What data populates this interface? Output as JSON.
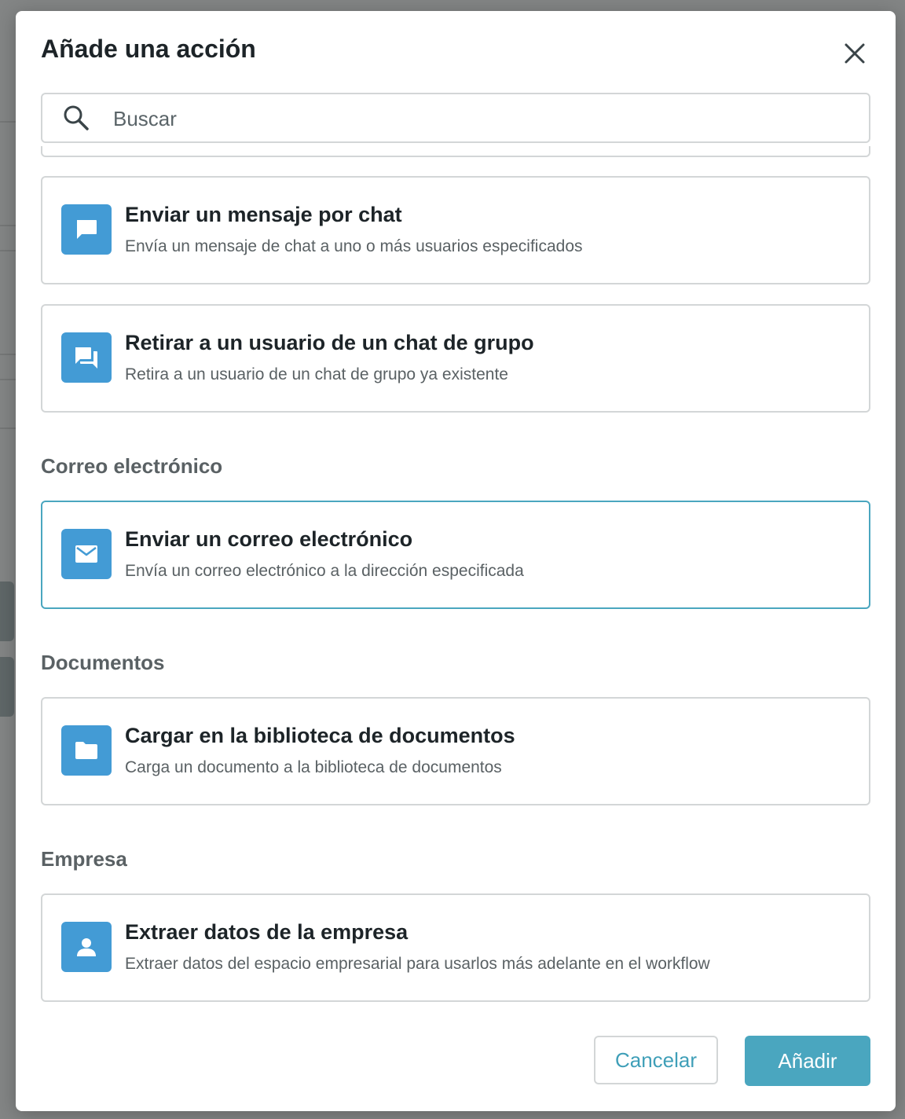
{
  "modal": {
    "title": "Añade una acción",
    "close_label": "×"
  },
  "search": {
    "placeholder": "Buscar",
    "value": ""
  },
  "sections": [
    {
      "heading": "",
      "items": [
        {
          "title": "Enviar un mensaje por chat",
          "description": "Envía un mensaje de chat a uno o más usuarios especificados",
          "icon": "chat-bubble-icon"
        },
        {
          "title": "Retirar a un usuario de un chat de grupo",
          "description": "Retira a un usuario de un chat de grupo ya existente",
          "icon": "group-chat-icon"
        }
      ]
    },
    {
      "heading": "Correo electrónico",
      "items": [
        {
          "title": "Enviar un correo electrónico",
          "description": "Envía un correo electrónico a la dirección especificada",
          "icon": "envelope-icon",
          "selected": true
        }
      ]
    },
    {
      "heading": "Documentos",
      "items": [
        {
          "title": "Cargar en la biblioteca de documentos",
          "description": "Carga un documento a la biblioteca de documentos",
          "icon": "folder-icon"
        }
      ]
    },
    {
      "heading": "Empresa",
      "items": [
        {
          "title": "Extraer datos de la empresa",
          "description": "Extraer datos del espacio empresarial para usarlos más adelante en el workflow",
          "icon": "person-icon"
        }
      ]
    }
  ],
  "footer": {
    "cancel_label": "Cancelar",
    "add_label": "Añadir"
  },
  "colors": {
    "accent": "#4aa6bf",
    "icon_tile": "#439bd5",
    "border": "#d3d6d7",
    "title_text": "#1d2428",
    "muted_text": "#5a6164"
  }
}
